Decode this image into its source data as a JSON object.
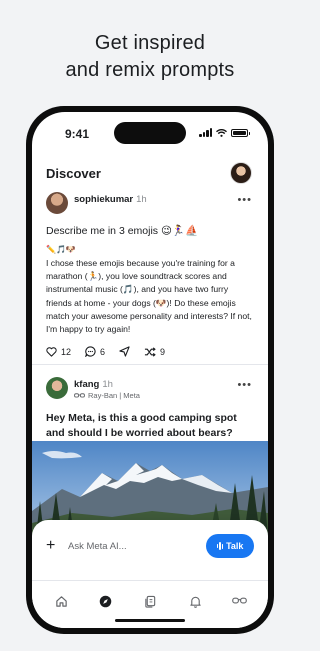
{
  "headline": {
    "line1": "Get inspired",
    "line2": "and remix prompts"
  },
  "status_bar": {
    "time": "9:41"
  },
  "header": {
    "title": "Discover"
  },
  "post1": {
    "username": "sophiekumar",
    "time_ago": "1h",
    "title": "Describe me in 3 emojis 😉🏃‍♀️⛵",
    "emojis": "✏️🎵🐶",
    "body": "I chose these emojis because you're training for a marathon (🏃), you love soundtrack scores and instrumental music (🎵), and you have two furry friends at home - your dogs (🐶)! Do these emojis match your awesome personality and interests? If not, I'm happy to try again!",
    "likes": "12",
    "comments": "6",
    "remixes": "9"
  },
  "post2": {
    "username": "kfang",
    "time_ago": "1h",
    "device": "Ray-Ban | Meta",
    "title": "Hey Meta, is this a good camping spot and should I be worried about bears?"
  },
  "composer": {
    "placeholder": "Ask Meta AI...",
    "talk_label": "Talk"
  },
  "tabbar": {
    "items": [
      "home-icon",
      "discover-icon",
      "library-icon",
      "notifications-icon",
      "glasses-icon"
    ]
  },
  "colors": {
    "accent": "#1877f2",
    "background": "#f2f3f5"
  }
}
